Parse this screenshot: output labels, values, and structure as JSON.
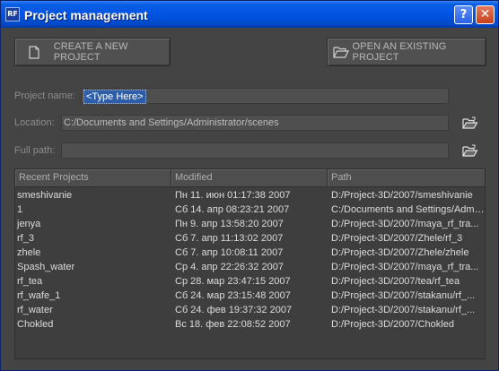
{
  "window": {
    "title": "Project management",
    "help_label": "?",
    "close_label": "✕",
    "app_icon_text": "RF"
  },
  "actions": {
    "create_label": "CREATE A NEW PROJECT",
    "open_label": "OPEN AN EXISTING PROJECT"
  },
  "form": {
    "project_name_label": "Project name:",
    "project_name_value": "<Type Here>",
    "location_label": "Location:",
    "location_value": "C:/Documents and Settings/Administrator/scenes",
    "full_path_label": "Full path:",
    "full_path_value": ""
  },
  "table": {
    "columns": [
      "Recent Projects",
      "Modified",
      "Path"
    ],
    "rows": [
      [
        "smeshivanie",
        "Пн 11. июн 01:17:38 2007",
        "D:/Project-3D/2007/smeshivanie"
      ],
      [
        "1",
        "Сб 14. апр 08:23:21 2007",
        "C:/Documents and Settings/Admi..."
      ],
      [
        "jenya",
        "Пн 9. апр 13:58:20 2007",
        "D:/Project-3D/2007/maya_rf_tra..."
      ],
      [
        "rf_3",
        "Сб 7. апр 11:13:02 2007",
        "D:/Project-3D/2007/Zhele/rf_3"
      ],
      [
        "zhele",
        "Сб 7. апр 10:08:11 2007",
        "D:/Project-3D/2007/Zhele/zhele"
      ],
      [
        "Spash_water",
        "Ср 4. апр 22:26:32 2007",
        "D:/Project-3D/2007/maya_rf_tra..."
      ],
      [
        "rf_tea",
        "Ср 28. мар 23:47:15 2007",
        "D:/Project-3D/2007/tea/rf_tea"
      ],
      [
        "rf_wafe_1",
        "Сб 24. мар 23:15:48 2007",
        "D:/Project-3D/2007/stakanu/rf_..."
      ],
      [
        "rf_water",
        "Сб 24. фев 19:37:32 2007",
        "D:/Project-3D/2007/stakanu/rf_..."
      ],
      [
        "Chokled",
        "Вс 18. фев 22:08:52 2007",
        "D:/Project-3D/2007/Chokled"
      ]
    ]
  },
  "icons": {
    "create": "new-document-icon",
    "open": "open-folder-icon",
    "browse": "folder-browse-icon"
  },
  "colors": {
    "titlebar": "#0054e3",
    "background": "#444444",
    "selection": "#2f5ea8"
  }
}
